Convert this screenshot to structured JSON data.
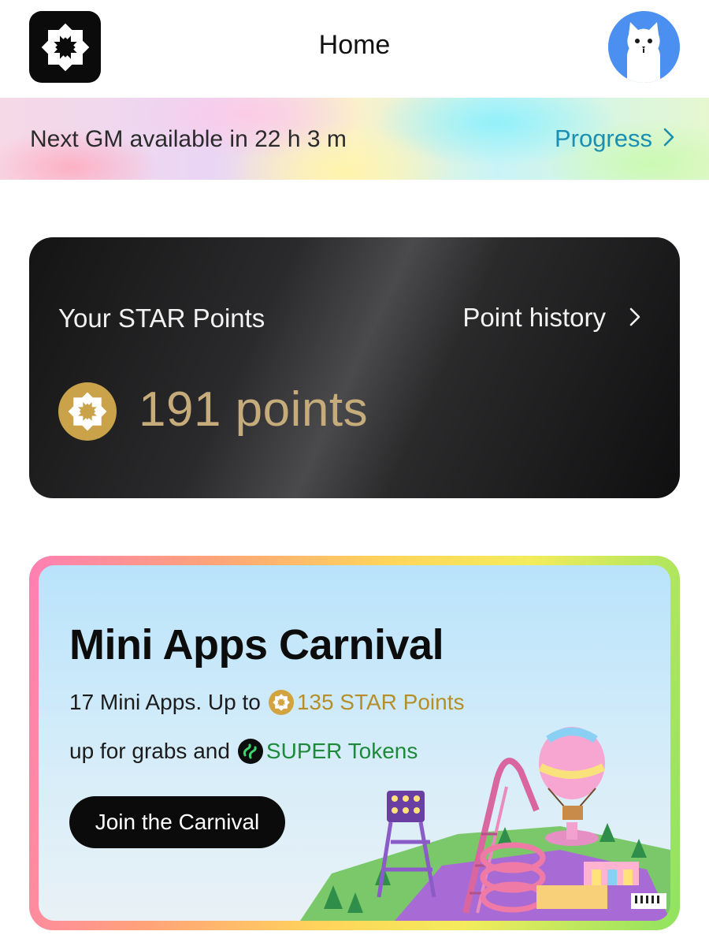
{
  "header": {
    "title": "Home",
    "logo_icon": "star-burst-logo-icon",
    "avatar_icon": "cat-avatar-icon"
  },
  "gm_banner": {
    "text": "Next GM available in 22 h 3 m",
    "progress_label": "Progress",
    "chevron_icon": "chevron-right-icon"
  },
  "points_card": {
    "label": "Your STAR Points",
    "history_label": "Point history",
    "value": "191 points",
    "coin_icon": "star-coin-icon"
  },
  "carnival": {
    "title": "Mini Apps Carnival",
    "line1_prefix": "17 Mini Apps. Up to",
    "line1_highlight": "135 STAR Points",
    "line2_prefix": "up for grabs and",
    "line2_highlight": "SUPER Tokens",
    "button_label": "Join the Carnival",
    "illustration": "carnival-theme-park-illustration"
  },
  "colors": {
    "progress_link": "#1a8fb1",
    "points_value": "#c5ac7a",
    "star_points": "#b58f2a",
    "super_tokens": "#1d8a3a",
    "avatar_bg": "#4b8ff0"
  }
}
